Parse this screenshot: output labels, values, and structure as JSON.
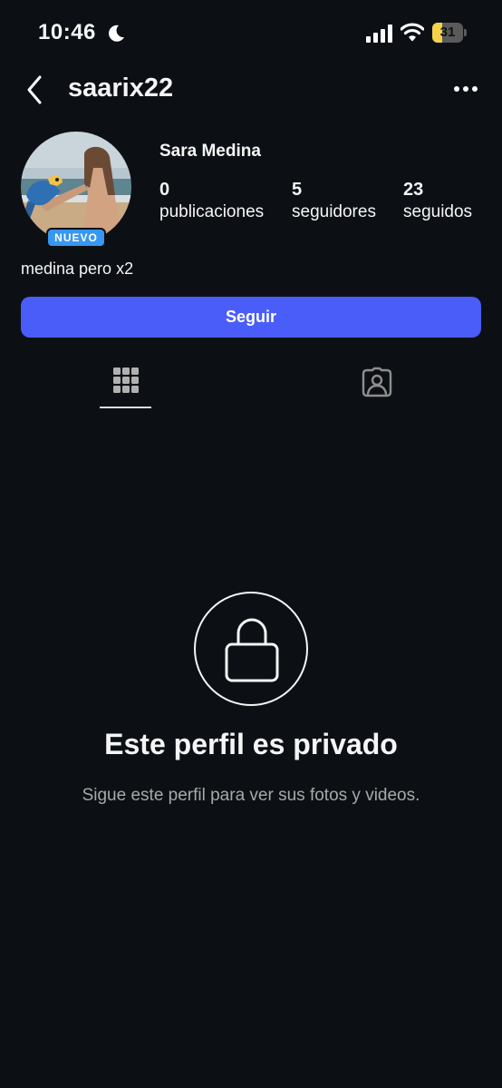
{
  "status_bar": {
    "time": "10:46",
    "battery_level": "31",
    "battery_fraction": 0.31,
    "battery_color": "#f4d24a",
    "icons": [
      "moon-icon",
      "signal-icon",
      "wifi-icon",
      "battery-icon"
    ]
  },
  "header": {
    "username": "saarix22",
    "back_icon": "chevron-left-icon",
    "more_icon": "more-horizontal-icon"
  },
  "profile": {
    "full_name": "Sara Medina",
    "badge": "NUEVO",
    "badge_color": "#3897f0",
    "bio": "medina pero x2",
    "stats": {
      "posts": {
        "value": "0",
        "label": "publicaciones"
      },
      "followers": {
        "value": "5",
        "label": "seguidores"
      },
      "following": {
        "value": "23",
        "label": "seguidos"
      }
    }
  },
  "actions": {
    "follow_label": "Seguir",
    "follow_color": "#4a5df9"
  },
  "tabs": [
    {
      "icon": "grid-icon",
      "active": true
    },
    {
      "icon": "tagged-person-icon",
      "active": false
    }
  ],
  "private_notice": {
    "icon": "lock-icon",
    "title": "Este perfil es privado",
    "subtitle": "Sigue este perfil para ver sus fotos y videos."
  },
  "theme": {
    "background": "#0c1014",
    "text": "#f5f5f5",
    "muted_text": "#a8a8a8"
  }
}
